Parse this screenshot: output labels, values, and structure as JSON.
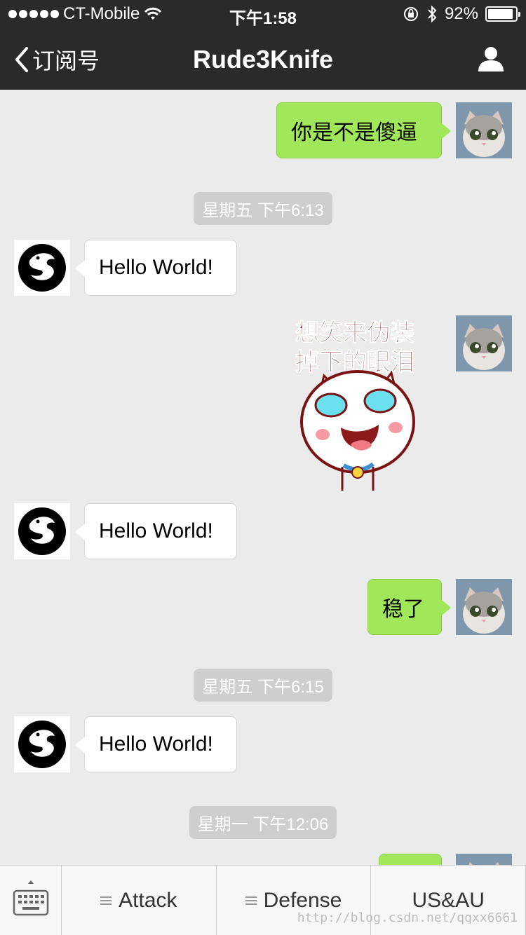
{
  "status_bar": {
    "carrier": "CT-Mobile",
    "time": "下午1:58",
    "battery": "92%",
    "battery_level": 0.92
  },
  "nav": {
    "back_label": "订阅号",
    "title": "Rude3Knife"
  },
  "messages": [
    {
      "kind": "text",
      "side": "out",
      "text": "你是不是傻逼"
    },
    {
      "kind": "timestamp",
      "text": "星期五 下午6:13"
    },
    {
      "kind": "text",
      "side": "in",
      "text": "Hello World!"
    },
    {
      "kind": "sticker",
      "side": "out",
      "text_line1": "想笑来伪装",
      "text_line2": "掉下的眼泪"
    },
    {
      "kind": "text",
      "side": "in",
      "text": "Hello World!"
    },
    {
      "kind": "text",
      "side": "out",
      "text": "稳了"
    },
    {
      "kind": "timestamp",
      "text": "星期五 下午6:15"
    },
    {
      "kind": "text",
      "side": "in",
      "text": "Hello World!"
    },
    {
      "kind": "timestamp",
      "text": "星期一 下午12:06"
    }
  ],
  "menu": {
    "items": [
      {
        "label": "Attack",
        "has_submenu": true
      },
      {
        "label": "Defense",
        "has_submenu": true
      },
      {
        "label": "US&AU",
        "has_submenu": false
      }
    ]
  },
  "watermark": "http://blog.csdn.net/qqxx6661",
  "icons": {
    "back": "chevron-left-icon",
    "profile": "person-icon",
    "keyboard": "keyboard-icon",
    "menu": "hamburger-icon"
  },
  "colors": {
    "nav_bg": "#2a2a2d",
    "chat_bg": "#ebebeb",
    "outgoing_bubble": "#a0e75a",
    "incoming_bubble": "#ffffff",
    "timestamp_bg": "#cecece"
  }
}
